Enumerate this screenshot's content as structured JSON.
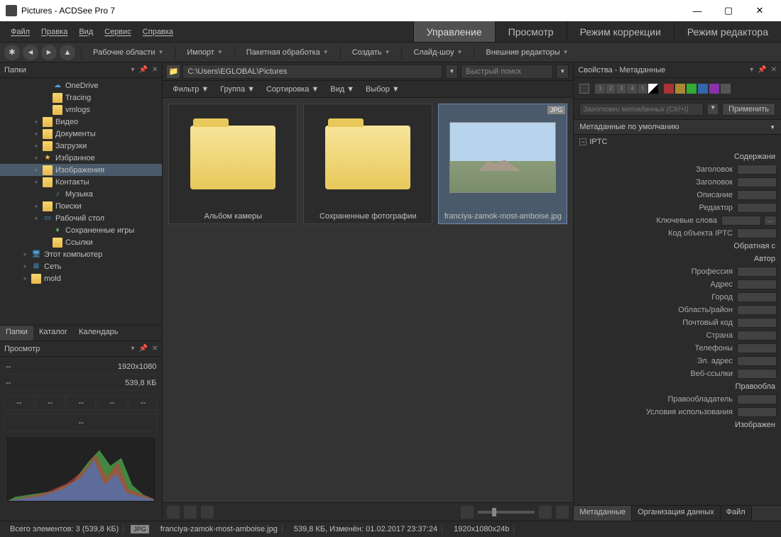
{
  "titlebar": {
    "title": "Pictures - ACDSee Pro 7"
  },
  "menu": {
    "file": "Файл",
    "edit": "Правка",
    "view": "Вид",
    "service": "Сервис",
    "help": "Справка"
  },
  "modes": {
    "manage": "Управление",
    "view": "Просмотр",
    "correction": "Режим коррекции",
    "editor": "Режим редактора"
  },
  "toolbar": {
    "workspaces": "Рабочие области",
    "import": "Импорт",
    "batch": "Пакетная обработка",
    "create": "Создать",
    "slideshow": "Слайд-шоу",
    "external": "Внешние редакторы"
  },
  "panels": {
    "folders": "Папки",
    "preview": "Просмотр",
    "properties": "Свойства - Метаданные"
  },
  "tree": [
    {
      "pad": 60,
      "exp": "",
      "ico": "cloud",
      "label": "OneDrive"
    },
    {
      "pad": 60,
      "exp": "",
      "ico": "fld",
      "label": "Tracing"
    },
    {
      "pad": 60,
      "exp": "",
      "ico": "fld",
      "label": "vmlogs"
    },
    {
      "pad": 46,
      "exp": "+",
      "ico": "fld",
      "label": "Видео"
    },
    {
      "pad": 46,
      "exp": "+",
      "ico": "fld",
      "label": "Документы"
    },
    {
      "pad": 46,
      "exp": "+",
      "ico": "fld",
      "label": "Загрузки"
    },
    {
      "pad": 46,
      "exp": "+",
      "ico": "star",
      "label": "Избранное"
    },
    {
      "pad": 46,
      "exp": "+",
      "ico": "fld",
      "label": "Изображения",
      "sel": true
    },
    {
      "pad": 46,
      "exp": "+",
      "ico": "fld",
      "label": "Контакты"
    },
    {
      "pad": 60,
      "exp": "",
      "ico": "music",
      "label": "Музыка"
    },
    {
      "pad": 46,
      "exp": "+",
      "ico": "fld",
      "label": "Поиски"
    },
    {
      "pad": 46,
      "exp": "+",
      "ico": "desk",
      "label": "Рабочий стол"
    },
    {
      "pad": 60,
      "exp": "",
      "ico": "green",
      "label": "Сохраненные игры"
    },
    {
      "pad": 60,
      "exp": "",
      "ico": "fld",
      "label": "Ссылки"
    },
    {
      "pad": 30,
      "exp": "+",
      "ico": "pc",
      "label": "Этот компьютер"
    },
    {
      "pad": 30,
      "exp": "+",
      "ico": "net",
      "label": "Сеть"
    },
    {
      "pad": 30,
      "exp": "+",
      "ico": "fld",
      "label": "mold"
    }
  ],
  "left_tabs": {
    "folders": "Папки",
    "catalog": "Каталог",
    "calendar": "Календарь"
  },
  "preview": {
    "dim": "1920x1080",
    "size": "539,8 КБ",
    "dash": "--"
  },
  "addr": {
    "path": "C:\\Users\\EGLOBAL\\Pictures",
    "search": "Быстрый поиск"
  },
  "filters": {
    "filter": "Фильтр",
    "group": "Группа",
    "sort": "Сортировка",
    "view": "Вид",
    "select": "Выбор"
  },
  "thumbs": {
    "album": "Альбом камеры",
    "saved": "Сохраненные фотографии",
    "file": "franciya-zamok-most-amboise.jpg",
    "badge": "JPG"
  },
  "meta": {
    "preset_ph": "Заготовки метаданных (Ctrl+I)",
    "apply": "Применить",
    "default": "Метаданные по умолчанию",
    "iptc": "IPTC",
    "rows": [
      "Содержани",
      "Заголовок",
      "Заголовок",
      "Описание",
      "Редактор",
      "Ключевые слова",
      "Код объекта IPTC",
      "Обратная с",
      "Автор",
      "Профессия",
      "Адрес",
      "Город",
      "Область/район",
      "Почтовый код",
      "Страна",
      "Телефоны",
      "Эл. адрес",
      "Веб-ссылки",
      "Правообла",
      "Правообладатель",
      "Условия использования",
      "Изображен"
    ]
  },
  "right_tabs": {
    "meta": "Метаданные",
    "org": "Организация данных",
    "file": "Файл"
  },
  "status": {
    "total": "Всего элементов: 3  (539,8 КБ)",
    "jpg": "JPG",
    "file": "franciya-zamok-most-amboise.jpg",
    "info": "539,8 КБ, Изменён: 01.02.2017 23:37:24",
    "dim": "1920x1080x24b"
  }
}
